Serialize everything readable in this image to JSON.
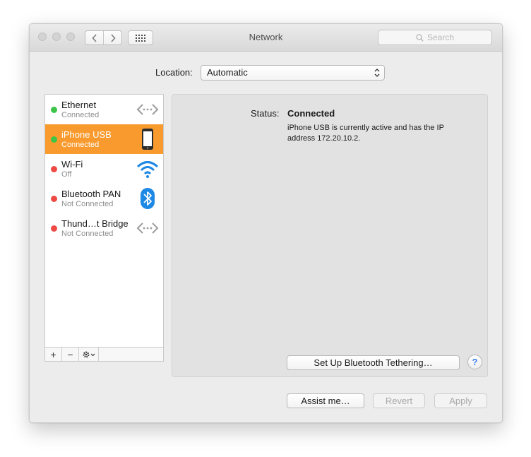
{
  "window": {
    "title": "Network"
  },
  "search": {
    "placeholder": "Search"
  },
  "location": {
    "label": "Location:",
    "value": "Automatic"
  },
  "services": [
    {
      "name": "Ethernet",
      "status": "Connected",
      "state": "connected",
      "icon": "ethernet-arrows-icon",
      "selected": false
    },
    {
      "name": "iPhone USB",
      "status": "Connected",
      "state": "connected",
      "icon": "iphone-icon",
      "selected": true
    },
    {
      "name": "Wi-Fi",
      "status": "Off",
      "state": "off",
      "icon": "wifi-icon",
      "selected": false
    },
    {
      "name": "Bluetooth PAN",
      "status": "Not Connected",
      "state": "disconnected",
      "icon": "bluetooth-icon",
      "selected": false
    },
    {
      "name": "Thund…t Bridge",
      "status": "Not Connected",
      "state": "disconnected",
      "icon": "ethernet-arrows-icon",
      "selected": false
    }
  ],
  "list_toolbar": {
    "add": "+",
    "remove": "−"
  },
  "detail": {
    "status_label": "Status:",
    "status_value": "Connected",
    "description": "iPhone USB is currently active and has the IP address 172.20.10.2.",
    "tether_button": "Set Up Bluetooth Tethering…",
    "help": "?"
  },
  "footer": {
    "assist": "Assist me…",
    "revert": "Revert",
    "apply": "Apply"
  },
  "colors": {
    "selection": "#f89a2d",
    "status_green": "#3cc447",
    "status_red": "#ee4a45",
    "accent_blue": "#1e88e5"
  }
}
